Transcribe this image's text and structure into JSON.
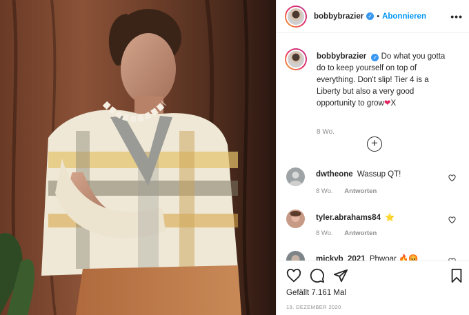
{
  "post": {
    "username": "bobbybrazier",
    "follow_label": "Abonnieren",
    "separator": "•",
    "more_label": "•••",
    "verified_mark": "✓"
  },
  "caption": {
    "username": "bobbybrazier",
    "text": "Do what you gotta do to keep yourself on top of everything. Don't slip! Tier 4 is a Liberty but also a very good opportunity to grow",
    "emoji": "❤",
    "suffix": "X",
    "time": "8 Wo."
  },
  "load_more_label": "+",
  "comments": [
    {
      "username": "dwtheone",
      "text": "Wassup QT!",
      "time": "8 Wo.",
      "reply_label": "Antworten"
    },
    {
      "username": "tyler.abrahams84",
      "text": "⭐",
      "time": "8 Wo.",
      "reply_label": "Antworten"
    },
    {
      "username": "mickyb_2021",
      "text": "Phwoar 🔥😡",
      "time": "",
      "reply_label": ""
    }
  ],
  "actions": {
    "like_icon": "heart-outline-icon",
    "comment_icon": "comment-bubble-icon",
    "share_icon": "paper-plane-icon",
    "save_icon": "bookmark-icon"
  },
  "likes_text": "Gefällt 7.161 Mal",
  "date_text": "19. DEZEMBER 2020",
  "colors": {
    "accent": "#0095f6",
    "verified": "#3897f0",
    "heart": "#e0245e",
    "muted": "#8e8e8e"
  }
}
